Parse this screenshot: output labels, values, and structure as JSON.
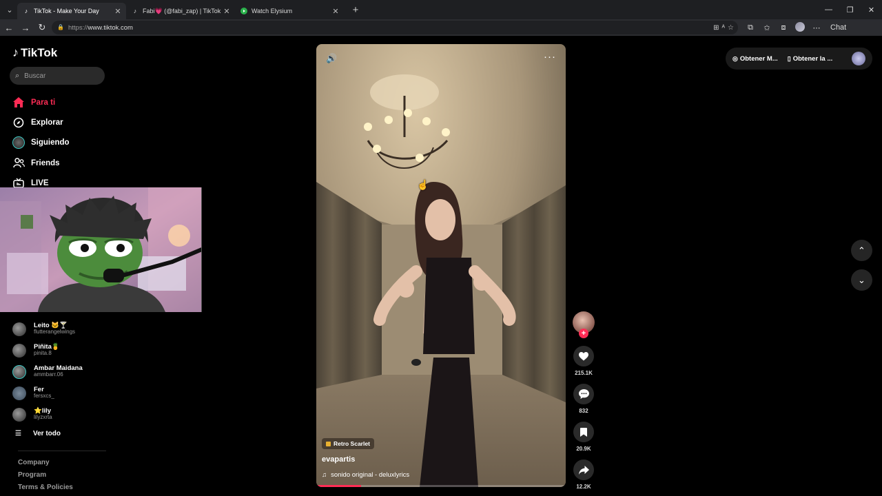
{
  "browser": {
    "tabs": [
      {
        "title": "TikTok - Make Your Day",
        "icon": "tiktok-icon",
        "active": true
      },
      {
        "title": "Fabi💗 (@fabi_zap) | TikTok",
        "icon": "tiktok-icon",
        "active": false
      },
      {
        "title": "Watch Elysium",
        "icon": "play-icon",
        "active": false
      }
    ],
    "url_proto": "https://",
    "url_host": "www.tiktok.com",
    "chat_label": "Chat"
  },
  "sidebar": {
    "brand": "TikTok",
    "search_placeholder": "Buscar",
    "nav": [
      {
        "label": "Para ti",
        "icon": "home-icon",
        "active": true
      },
      {
        "label": "Explorar",
        "icon": "compass-icon"
      },
      {
        "label": "Siguiendo",
        "icon": "following-avatar-icon"
      },
      {
        "label": "Friends",
        "icon": "friends-icon"
      },
      {
        "label": "LIVE",
        "icon": "live-icon"
      }
    ],
    "following": [
      {
        "name": "Leito 🐱🍸",
        "handle": "flutterangelwings"
      },
      {
        "name": "Piñita🍍",
        "handle": "pinita.8"
      },
      {
        "name": "Ambar Maidana",
        "handle": "ammbarr.06"
      },
      {
        "name": "Fer",
        "handle": "fersxcs_"
      },
      {
        "name": "⭐lily",
        "handle": "lilyzxrta"
      }
    ],
    "see_all": "Ver todo",
    "footer": [
      "Company",
      "Program",
      "Terms & Policies"
    ]
  },
  "video": {
    "tag": "Retro Scarlet",
    "author": "evapartis",
    "sound": "sonido original - deluxlyrics",
    "progress": 0.18
  },
  "actions": {
    "likes": "215.1K",
    "comments": "832",
    "saves": "20.9K",
    "shares": "12.2K"
  },
  "header_right": {
    "coins": "Obtener M...",
    "app": "Obtener la ..."
  },
  "colors": {
    "accent": "#fe2c55",
    "background": "#000000"
  }
}
